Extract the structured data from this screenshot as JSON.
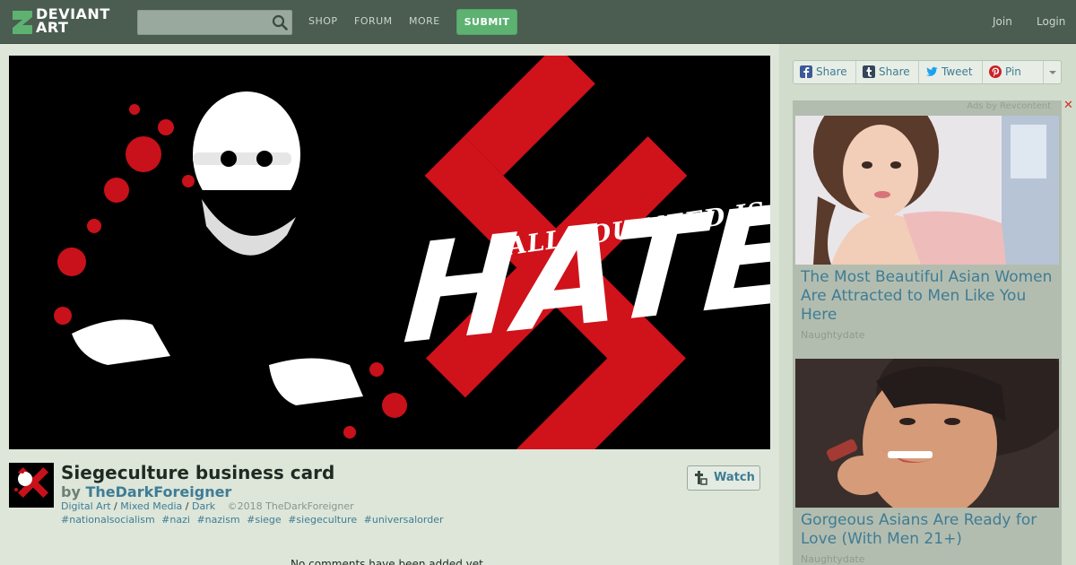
{
  "brand": {
    "logo_line1": "DEVIANT",
    "logo_line2": "ART",
    "accent": "#5db272"
  },
  "header": {
    "search_placeholder": "",
    "nav": [
      "SHOP",
      "FORUM",
      "MORE"
    ],
    "submit_label": "SUBMIT",
    "join_label": "Join",
    "login_label": "Login"
  },
  "artwork": {
    "tagline": "ALL YOU NEED IS",
    "headline": "HATE"
  },
  "deviation": {
    "title": "Siegeculture business card",
    "by_prefix": "by",
    "author": "TheDarkForeigner",
    "categories": [
      "Digital Art",
      "Mixed Media",
      "Dark"
    ],
    "category_separator": "/",
    "copyright": "©2018 TheDarkForeigner",
    "tags": [
      "#nationalsocialism",
      "#nazi",
      "#nazism",
      "#siege",
      "#siegeculture",
      "#universalorder"
    ],
    "watch_label": "Watch",
    "comments_text": "No comments have been added yet."
  },
  "share": {
    "buttons": [
      {
        "label": "Share",
        "icon": "facebook-icon",
        "color": "#3b5998"
      },
      {
        "label": "Share",
        "icon": "tumblr-icon",
        "color": "#35465c"
      },
      {
        "label": "Tweet",
        "icon": "twitter-icon",
        "color": "#1da1f2"
      },
      {
        "label": "Pin",
        "icon": "pinterest-icon",
        "color": "#cb2027"
      }
    ]
  },
  "ads": {
    "provider_label": "Ads by Revcontent",
    "close_label": "✕",
    "items": [
      {
        "title": "The Most Beautiful Asian Women Are Attracted to Men Like You Here",
        "source": "Naughtydate"
      },
      {
        "title": "Gorgeous Asians Are Ready for Love (With Men 21+)",
        "source": "Naughtydate"
      }
    ]
  }
}
